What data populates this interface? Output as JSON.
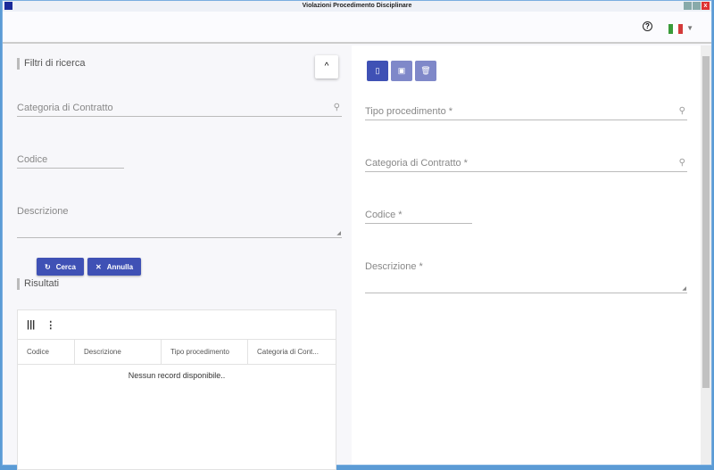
{
  "window": {
    "title": "Violazioni Procedimento Disciplinare"
  },
  "topbar": {
    "help_icon": "question-circle-icon",
    "language": "it",
    "flag_colors": [
      "#3a9b3a",
      "#ffffff",
      "#d33a3a"
    ]
  },
  "filters": {
    "title": "Filtri di ricerca",
    "categoria_label": "Categoria di Contratto",
    "codice_label": "Codice",
    "descrizione_label": "Descrizione",
    "search_button": "Cerca",
    "cancel_button": "Annulla"
  },
  "results": {
    "title": "Risultati",
    "columns": [
      "Codice",
      "Descrizione",
      "Tipo procedimento",
      "Categoria di Cont..."
    ],
    "empty_message": "Nessun record disponibile.."
  },
  "form": {
    "tipo_label": "Tipo procedimento *",
    "categoria_label": "Categoria di Contratto *",
    "codice_label": "Codice *",
    "descrizione_label": "Descrizione *"
  },
  "colors": {
    "primary": "#3f51b5",
    "primary_disabled": "#7f88c9"
  }
}
